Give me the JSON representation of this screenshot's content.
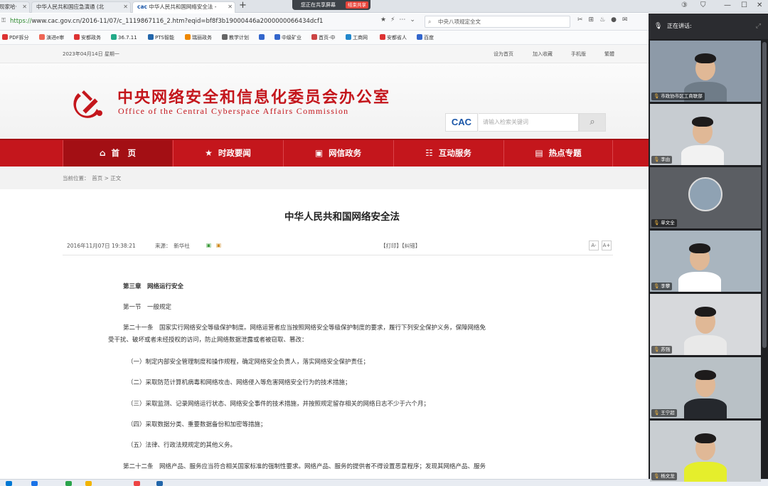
{
  "browser": {
    "tabs": [
      {
        "label": "现家哈·"
      },
      {
        "label": "中华人民共和国应急演通 (北"
      },
      {
        "label": "中华人民共和国网络安全法 -"
      }
    ],
    "share": {
      "label": "您正在共享屏幕",
      "stop": "结束共享"
    },
    "url": {
      "scheme": "https://",
      "rest": "www.cac.gov.cn/2016-11/07/c_1119867116_2.htm?eqid=bf8f3b19000446a2000000066434dcf1"
    },
    "search_value": "中央八项规定全文",
    "bookmarks": [
      "PDF拆分",
      "演进e审",
      "安都政务",
      "36.7.11",
      "PTS智能",
      "瑞丽政务",
      "教学计划",
      "",
      "中级矿业",
      "首页-中",
      "工商网",
      "安都省人",
      "百度"
    ]
  },
  "site": {
    "date": "2023年04月14日 星期一",
    "toplinks": [
      "设为首页",
      "加入收藏",
      "手机版",
      "繁體"
    ],
    "logo_cn": "中央网络安全和信息化委员会办公室",
    "logo_en": "Office of the Central Cyberspace Affairs Commission",
    "cac": "CAC",
    "search_placeholder": "请输入检索关键词",
    "nav": [
      "首　页",
      "时政要闻",
      "网信政务",
      "互动服务",
      "热点专题"
    ],
    "breadcrumb": "当前位置：　首页 > 正文"
  },
  "article": {
    "title": "中华人民共和国网络安全法",
    "time": "2016年11月07日 19:38:21",
    "source": "来源：　新华社",
    "print": "【打印】【纠错】",
    "font_small": "A-",
    "font_big": "A+",
    "paragraphs": [
      "第三章　网络运行安全",
      "第一节　一般规定",
      "第二十一条　国家实行网络安全等级保护制度。网络运营者应当按照网络安全等级保护制度的要求，履行下列安全保护义务，保障网络免",
      "受干扰、破坏或者未经授权的访问，防止网络数据泄露或者被窃取、篡改：",
      "（一）制定内部安全管理制度和操作规程，确定网络安全负责人，落实网络安全保护责任；",
      "（二）采取防范计算机病毒和网络攻击、网络侵入等危害网络安全行为的技术措施；",
      "（三）采取监测、记录网络运行状态、网络安全事件的技术措施，并按照规定留存相关的网络日志不少于六个月；",
      "（四）采取数据分类、重要数据备份和加密等措施；",
      "（五）法律、行政法规规定的其他义务。",
      "第二十二条　网络产品、服务应当符合相关国家标准的强制性要求。网络产品、服务的提供者不得设置恶意程序；发现其网络产品、服务"
    ]
  },
  "meeting": {
    "header": "正在讲话:",
    "participants": [
      {
        "name": "市政协市区工商联部"
      },
      {
        "name": "李由"
      },
      {
        "name": "单文全"
      },
      {
        "name": "李攀"
      },
      {
        "name": "苏强"
      },
      {
        "name": "王宁超"
      },
      {
        "name": "杨文龙"
      }
    ]
  },
  "colors": {
    "brand_red": "#c4161c",
    "nav_dark_red": "#a30f14",
    "panel_bg": "#1e1f22"
  }
}
